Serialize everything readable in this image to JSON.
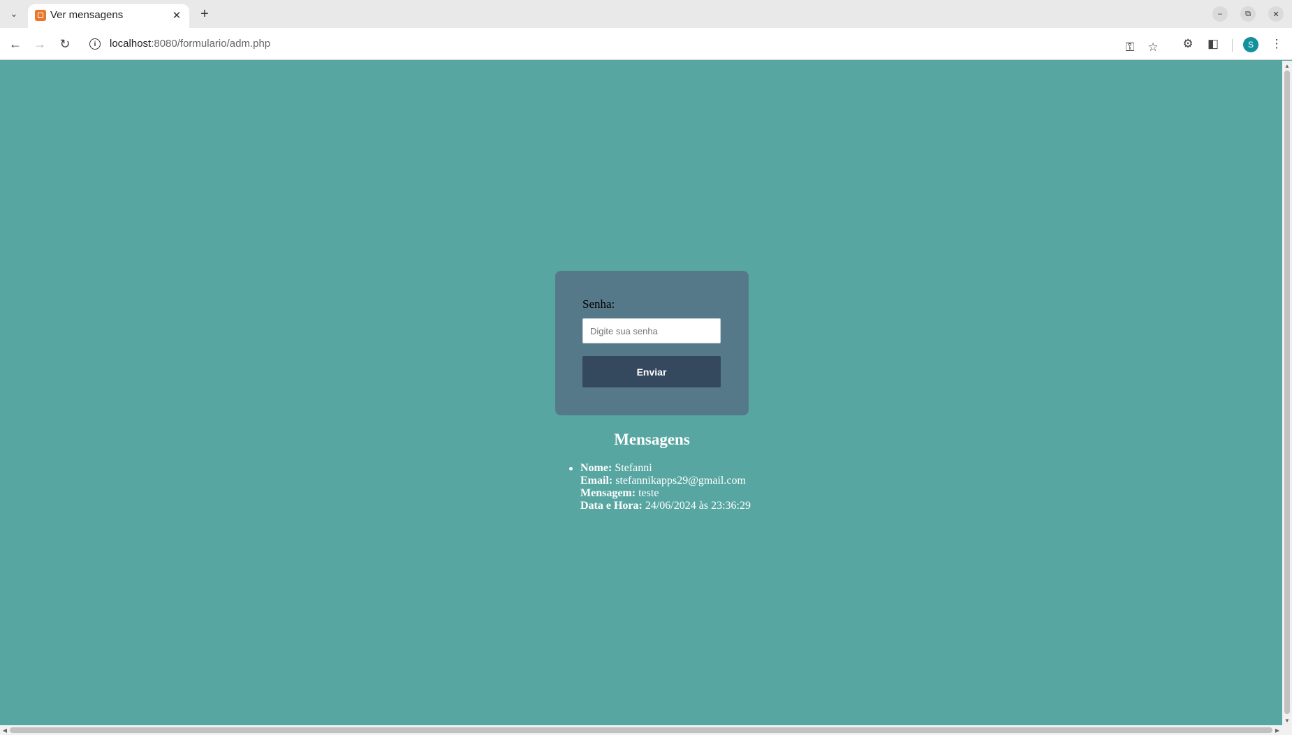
{
  "browser": {
    "tab_title": "Ver mensagens",
    "url_host": "localhost",
    "url_path": ":8080/formulario/adm.php",
    "profile_initial": "S",
    "icons": [
      "tab-list-icon",
      "favicon-icon",
      "close-icon",
      "plus-icon",
      "minimize-icon",
      "restore-icon",
      "window-close-icon",
      "back-arrow-icon",
      "forward-arrow-icon",
      "reload-icon",
      "site-info-icon",
      "key-icon",
      "star-icon",
      "bug-icon",
      "puzzle-icon",
      "kebab-menu-icon"
    ]
  },
  "form": {
    "senha_label": "Senha:",
    "senha_placeholder": "Digite sua senha",
    "submit_label": "Enviar"
  },
  "messages": {
    "title": "Mensagens",
    "items": [
      {
        "nome_label": "Nome:",
        "nome": "Stefanni",
        "email_label": "Email:",
        "email": "stefannikapps29@gmail.com",
        "mensagem_label": "Mensagem:",
        "mensagem": "teste",
        "data_label": "Data e Hora:",
        "data": "24/06/2024 às 23:36:29"
      }
    ]
  },
  "colors": {
    "page_background": "#57a6a1",
    "card_background": "#56798a",
    "button_background": "#34495e",
    "favicon": "#e8762b",
    "profile_avatar": "#12919c"
  }
}
